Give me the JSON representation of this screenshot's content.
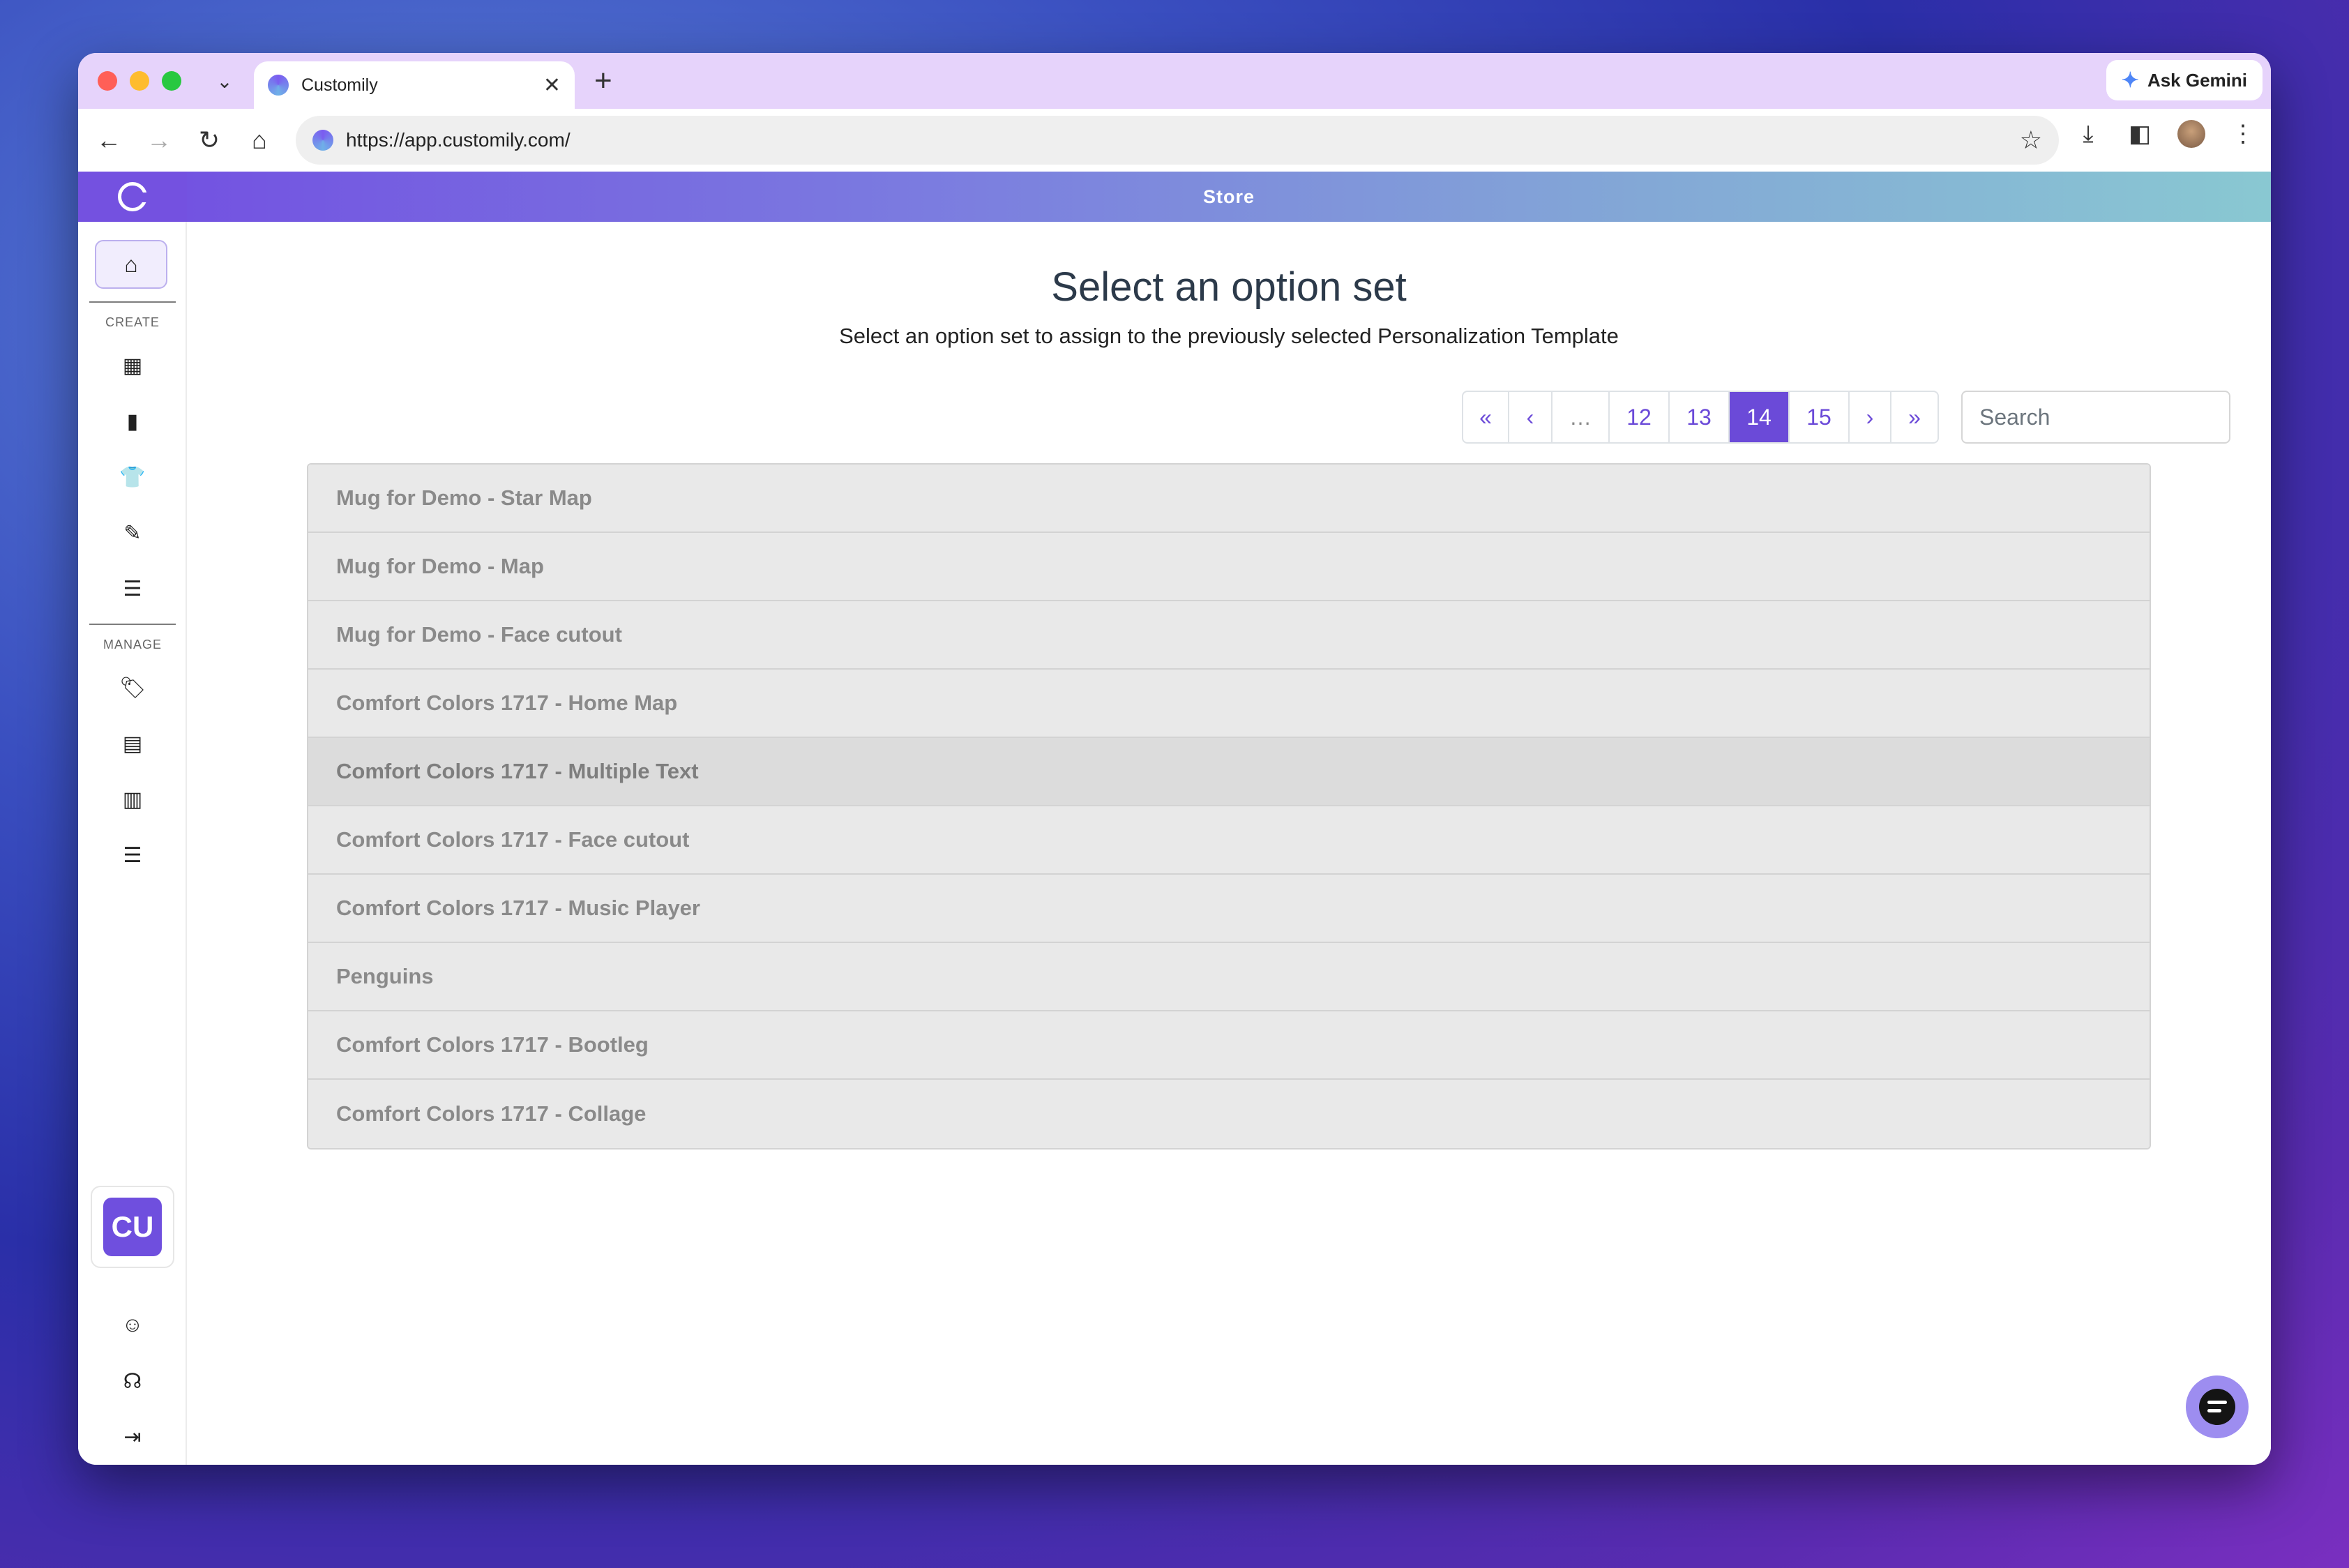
{
  "browser": {
    "tab_title": "Customily",
    "tab_close": "✕",
    "new_tab": "+",
    "ask_gemini": "Ask Gemini",
    "url": "https://app.customily.com/"
  },
  "app": {
    "topbar_title": "Store",
    "sidebar": {
      "create_label": "CREATE",
      "manage_label": "MANAGE",
      "user_initials": "CU"
    }
  },
  "main": {
    "title": "Select an option set",
    "subtitle": "Select an option set to assign to the previously selected Personalization Template",
    "pagination": {
      "first": "«",
      "prev": "‹",
      "ellipsis": "…",
      "pages": [
        "12",
        "13",
        "14",
        "15"
      ],
      "active_page": "14",
      "next": "›",
      "last": "»"
    },
    "search_placeholder": "Search",
    "option_sets": [
      "Mug for Demo - Star Map",
      "Mug for Demo - Map",
      "Mug for Demo - Face cutout",
      "Comfort Colors 1717 - Home Map",
      "Comfort Colors 1717 - Multiple Text",
      "Comfort Colors 1717 - Face cutout",
      "Comfort Colors 1717 - Music Player",
      "Penguins",
      "Comfort Colors 1717 - Bootleg",
      "Comfort Colors 1717 - Collage"
    ]
  },
  "colors": {
    "accent": "#6b4ad8",
    "topbar_start": "#7353e1",
    "topbar_end": "#89c8d2",
    "list_bg": "#e9e9e9"
  }
}
